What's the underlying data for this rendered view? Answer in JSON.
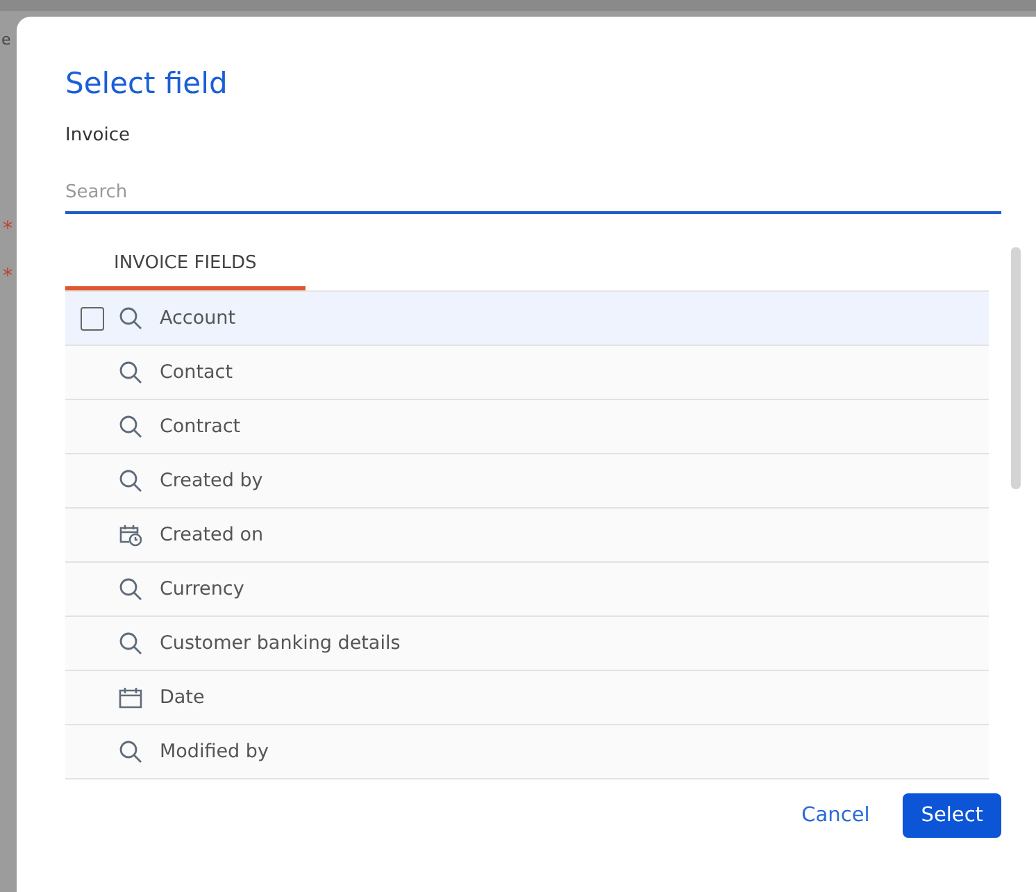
{
  "backdrop": {
    "fragment": "e",
    "marks": [
      "*",
      "*"
    ]
  },
  "dialog": {
    "title": "Select field",
    "subtitle": "Invoice"
  },
  "search": {
    "placeholder": "Search"
  },
  "tabs": [
    {
      "label": "INVOICE FIELDS",
      "selected": true
    }
  ],
  "row_checkbox_checked": false,
  "fields": [
    {
      "label": "Account",
      "kind": "lookup",
      "selected": true
    },
    {
      "label": "Contact",
      "kind": "lookup",
      "selected": false
    },
    {
      "label": "Contract",
      "kind": "lookup",
      "selected": false
    },
    {
      "label": "Created by",
      "kind": "lookup",
      "selected": false
    },
    {
      "label": "Created on",
      "kind": "datetime",
      "selected": false
    },
    {
      "label": "Currency",
      "kind": "lookup",
      "selected": false
    },
    {
      "label": "Customer banking details",
      "kind": "lookup",
      "selected": false
    },
    {
      "label": "Date",
      "kind": "date",
      "selected": false
    },
    {
      "label": "Modified by",
      "kind": "lookup",
      "selected": false
    }
  ],
  "buttons": [
    {
      "label": "Cancel",
      "kind": "link"
    },
    {
      "label": "Select",
      "kind": "primary"
    }
  ]
}
